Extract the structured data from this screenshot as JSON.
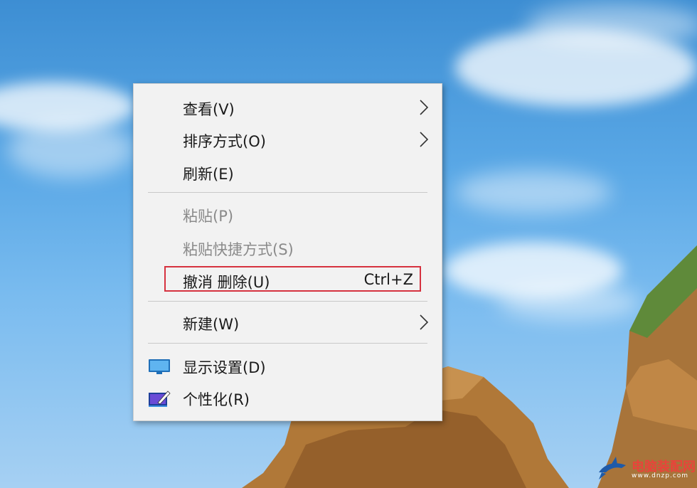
{
  "menu": {
    "items": [
      {
        "label": "查看(V)",
        "submenu": true,
        "disabled": false
      },
      {
        "label": "排序方式(O)",
        "submenu": true,
        "disabled": false
      },
      {
        "label": "刷新(E)",
        "submenu": false,
        "disabled": false
      },
      {
        "label": "粘贴(P)",
        "submenu": false,
        "disabled": true
      },
      {
        "label": "粘贴快捷方式(S)",
        "submenu": false,
        "disabled": true
      },
      {
        "label": "撤消 删除(U)",
        "shortcut": "Ctrl+Z",
        "submenu": false,
        "disabled": false,
        "highlighted": true
      },
      {
        "label": "新建(W)",
        "submenu": true,
        "disabled": false
      },
      {
        "label": "显示设置(D)",
        "icon": "display-icon",
        "submenu": false,
        "disabled": false
      },
      {
        "label": "个性化(R)",
        "icon": "personalize-icon",
        "submenu": false,
        "disabled": false
      }
    ]
  },
  "watermark": {
    "title": "电脑装配网",
    "subtitle": "www.dnzp.com"
  },
  "colors": {
    "highlight": "#d6323f",
    "menu_bg": "#f2f2f2"
  }
}
